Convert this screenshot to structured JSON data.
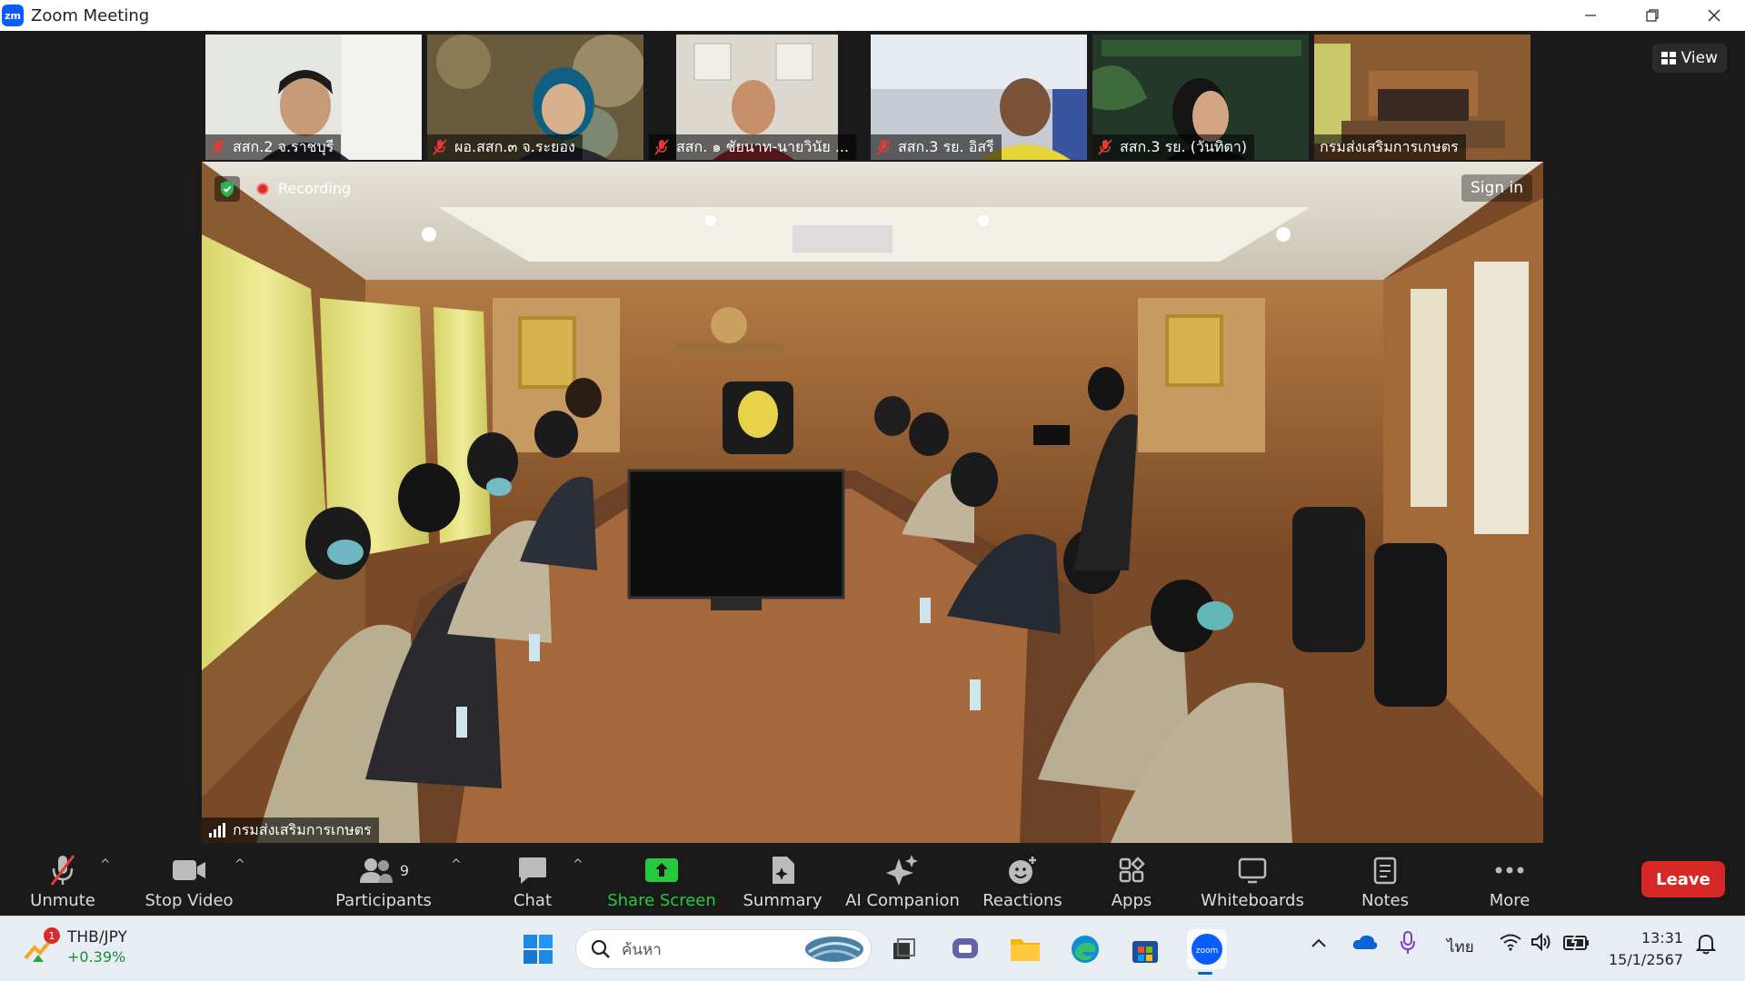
{
  "window": {
    "app_logo": "zm",
    "title": "Zoom Meeting",
    "minimize": "—",
    "restore": "❐",
    "close": "✕"
  },
  "thumbnails": [
    {
      "name": "สสก.2 จ.ราชบุรี",
      "muted": true,
      "bg": "#e8e8e4"
    },
    {
      "name": "ผอ.สสก.๓ จ.ระยอง",
      "muted": true,
      "bg": "#6a5a3a"
    },
    {
      "name": "สสก. ๑ ชัยนาท-นายวินัย ...",
      "muted": true,
      "bg": "#d8d3c8"
    },
    {
      "name": "สสก.3 รย. อิสรี",
      "muted": true,
      "bg": "#c7cbd2"
    },
    {
      "name": "สสก.3 รย.  (วันทิตา)",
      "muted": true,
      "bg": "#2f4a2b"
    },
    {
      "name": "กรมส่งเสริมการเกษตร",
      "muted": false,
      "bg": "#8a5a30",
      "active": true
    }
  ],
  "view_button": "View",
  "main_video": {
    "recording": "Recording",
    "sign_in": "Sign in",
    "speaker": "กรมส่งเสริมการเกษตร"
  },
  "toolbar": {
    "unmute": "Unmute",
    "stop_video": "Stop Video",
    "participants": "Participants",
    "participants_count": "9",
    "chat": "Chat",
    "share_screen": "Share Screen",
    "summary": "Summary",
    "ai_companion": "AI Companion",
    "reactions": "Reactions",
    "apps": "Apps",
    "whiteboards": "Whiteboards",
    "notes": "Notes",
    "more": "More",
    "leave": "Leave"
  },
  "taskbar": {
    "stock_name": "THB/JPY",
    "stock_change": "+0.39%",
    "stock_badge": "1",
    "search_placeholder": "ค้นหา",
    "language": "ไทย",
    "time": "13:31",
    "date": "15/1/2567"
  },
  "colors": {
    "accent_green": "#27c93f",
    "leave_red": "#d72828",
    "zoom_blue": "#0b5cff"
  }
}
